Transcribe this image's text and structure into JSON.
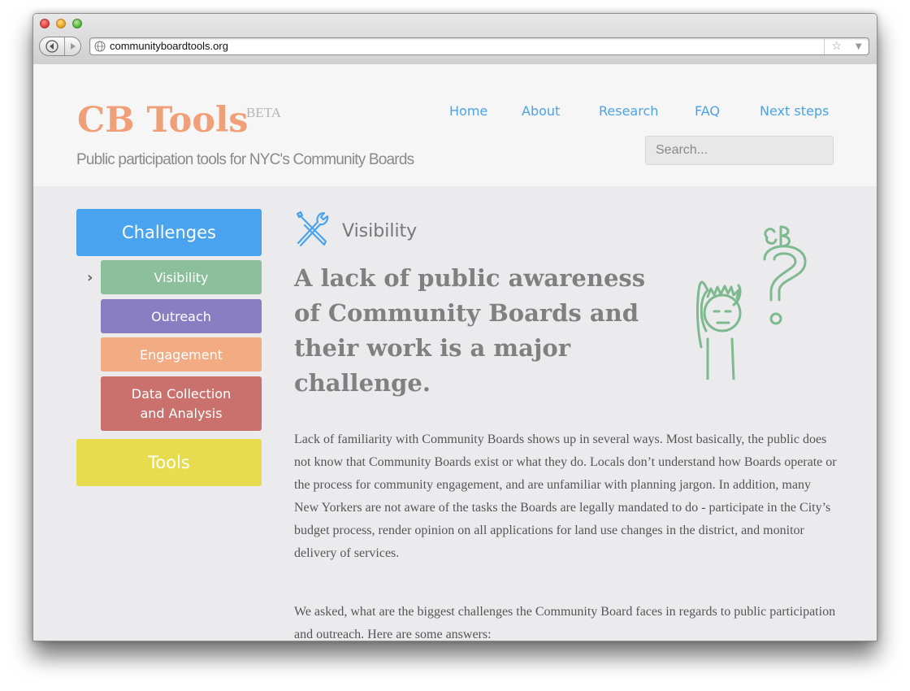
{
  "browser": {
    "url": "communityboardtools.org"
  },
  "site": {
    "logo": "CB Tools",
    "beta": "BETA",
    "tagline": "Public participation tools for NYC's Community Boards",
    "search_placeholder": "Search...",
    "nav": [
      "Home",
      "About",
      "Research",
      "FAQ",
      "Next steps"
    ]
  },
  "sidebar": {
    "challenges": "Challenges",
    "items": [
      "Visibility",
      "Outreach",
      "Engagement",
      "Data Collection and Analysis"
    ],
    "tools": "Tools"
  },
  "main": {
    "section_title": "Visibility",
    "headline": "A lack of public awareness of Community Boards and their work is a major challenge.",
    "paragraph1": "Lack of familiarity with Community Boards shows up in several ways. Most basically, the public does not know that Community Boards exist or what they do. Locals don’t understand how Boards operate or the process for community engagement, and are unfamiliar with planning jargon. In addition, many New Yorkers are not aware of the tasks the Boards are legally mandated to do  - participate in the City’s budget process, render opinion on all applications for land use changes in the district, and monitor delivery of services.",
    "paragraph2": "We asked, what are the biggest challenges the Community Board faces in regards to public participation and outreach. Here are some answers:",
    "doodle_text": "CB"
  },
  "colors": {
    "logo": "#f0a078",
    "nav": "#4ba3e6",
    "challenges": "#4aa3ee",
    "visibility": "#8cbf9b",
    "outreach": "#8a7ec3",
    "engagement": "#f2ab82",
    "data": "#ca716d",
    "tools": "#e6dc4e",
    "doodle": "#7fb98f"
  }
}
